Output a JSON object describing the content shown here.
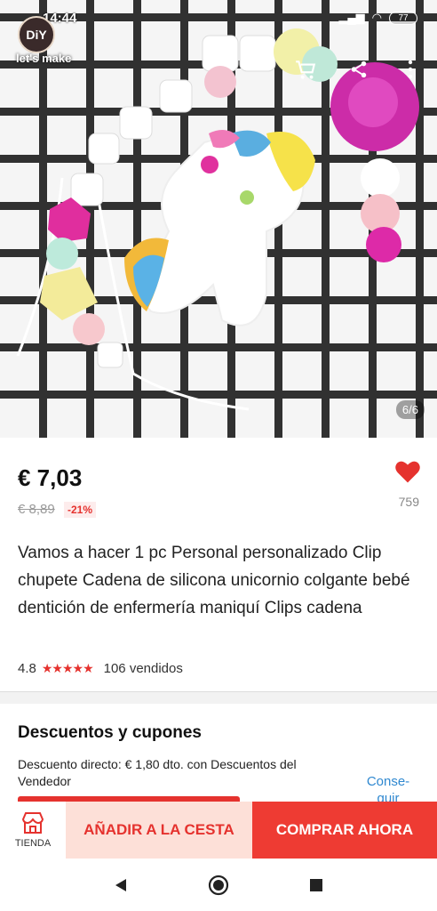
{
  "status": {
    "time": "14:44",
    "battery": "77"
  },
  "store": {
    "logo_text": "DiY",
    "brand": "let's make"
  },
  "gallery": {
    "indicator": "6/6"
  },
  "product": {
    "price": "€ 7,03",
    "old_price": "€ 8,89",
    "discount": "-21%",
    "wishlist_count": "759",
    "title": "Vamos a hacer 1 pc Personal personalizado Clip chupete Cadena de silicona unicornio colgante bebé dentición de enfermería maniquí Clips cadena",
    "rating": "4.8",
    "stars": "★★★★★",
    "sold": "106 vendidos"
  },
  "coupons": {
    "title": "Descuentos y cupones",
    "text": "Descuento directo: € 1,80 dto. con Descuentos del Vendedor",
    "link": "Conse-guir"
  },
  "actions": {
    "store_label": "TIENDA",
    "add_to_cart": "AÑADIR A LA CESTA",
    "buy_now": "COMPRAR AHORA"
  },
  "colors": {
    "accent": "#ee3b33",
    "cart_bg": "#fde0d8",
    "link": "#2f88d0"
  }
}
